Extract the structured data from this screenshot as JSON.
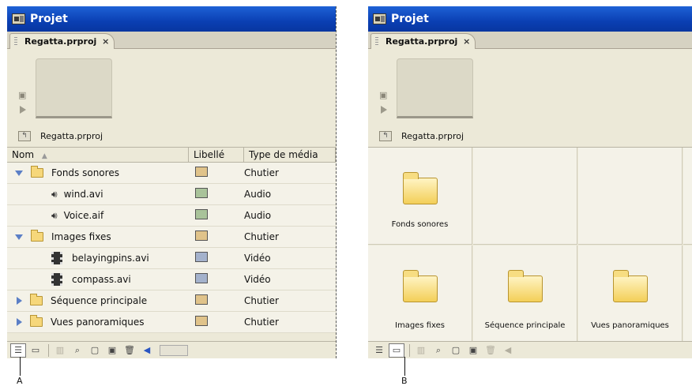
{
  "panel_a": {
    "title": "Projet",
    "tab_label": "Regatta.prproj",
    "tab_close": "×",
    "path": "Regatta.prproj",
    "columns": [
      "Nom",
      "Libellé",
      "Type de média"
    ],
    "rows": [
      {
        "name": "Fonds sonores",
        "type": "Chutier",
        "color": "#e0c38a"
      },
      {
        "name": "wind.avi",
        "type": "Audio",
        "color": "#a9c39a"
      },
      {
        "name": "Voice.aif",
        "type": "Audio",
        "color": "#a9c39a"
      },
      {
        "name": "Images fixes",
        "type": "Chutier",
        "color": "#e0c38a"
      },
      {
        "name": "belayingpins.avi",
        "type": "Vidéo",
        "color": "#a4b2cc"
      },
      {
        "name": "compass.avi",
        "type": "Vidéo",
        "color": "#a4b2cc"
      },
      {
        "name": "Séquence principale",
        "type": "Chutier",
        "color": "#e0c38a"
      },
      {
        "name": "Vues panoramiques",
        "type": "Chutier",
        "color": "#e0c38a"
      }
    ]
  },
  "panel_b": {
    "title": "Projet",
    "tab_label": "Regatta.prproj",
    "tab_close": "×",
    "path": "Regatta.prproj",
    "items": [
      "Fonds sonores",
      "Images fixes",
      "Séquence principale",
      "Vues panoramiques"
    ]
  },
  "callouts": {
    "a": "A",
    "b": "B"
  }
}
